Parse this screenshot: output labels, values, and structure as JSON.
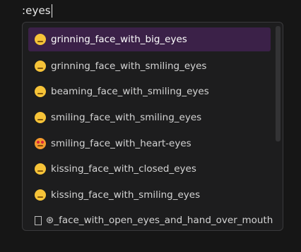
{
  "editor": {
    "typed_text": ":eyes"
  },
  "autocomplete": {
    "items": [
      {
        "label": "grinning_face_with_big_eyes",
        "icon": "grinning-face-with-big-eyes-emoji",
        "selected": true
      },
      {
        "label": "grinning_face_with_smiling_eyes",
        "icon": "grinning-face-with-smiling-eyes-emoji",
        "selected": false
      },
      {
        "label": "beaming_face_with_smiling_eyes",
        "icon": "beaming-face-with-smiling-eyes-emoji",
        "selected": false
      },
      {
        "label": "smiling_face_with_smiling_eyes",
        "icon": "smiling-face-with-smiling-eyes-emoji",
        "selected": false
      },
      {
        "label": "smiling_face_with_heart-eyes",
        "icon": "smiling-face-with-heart-eyes-emoji",
        "selected": false
      },
      {
        "label": "kissing_face_with_closed_eyes",
        "icon": "kissing-face-with-closed-eyes-emoji",
        "selected": false
      },
      {
        "label": "kissing_face_with_smiling_eyes",
        "icon": "kissing-face-with-smiling-eyes-emoji",
        "selected": false
      },
      {
        "label": "_face_with_open_eyes_and_hand_over_mouth",
        "prefix_glyph": "⊛",
        "icon": "missing-glyph-box-icon",
        "selected": false
      }
    ]
  },
  "colors": {
    "background": "#161616",
    "popup_background": "#1d1d1e",
    "selected_row": "#3b2148",
    "text": "#d4d4d4",
    "emoji_yellow": "#f6c338"
  }
}
